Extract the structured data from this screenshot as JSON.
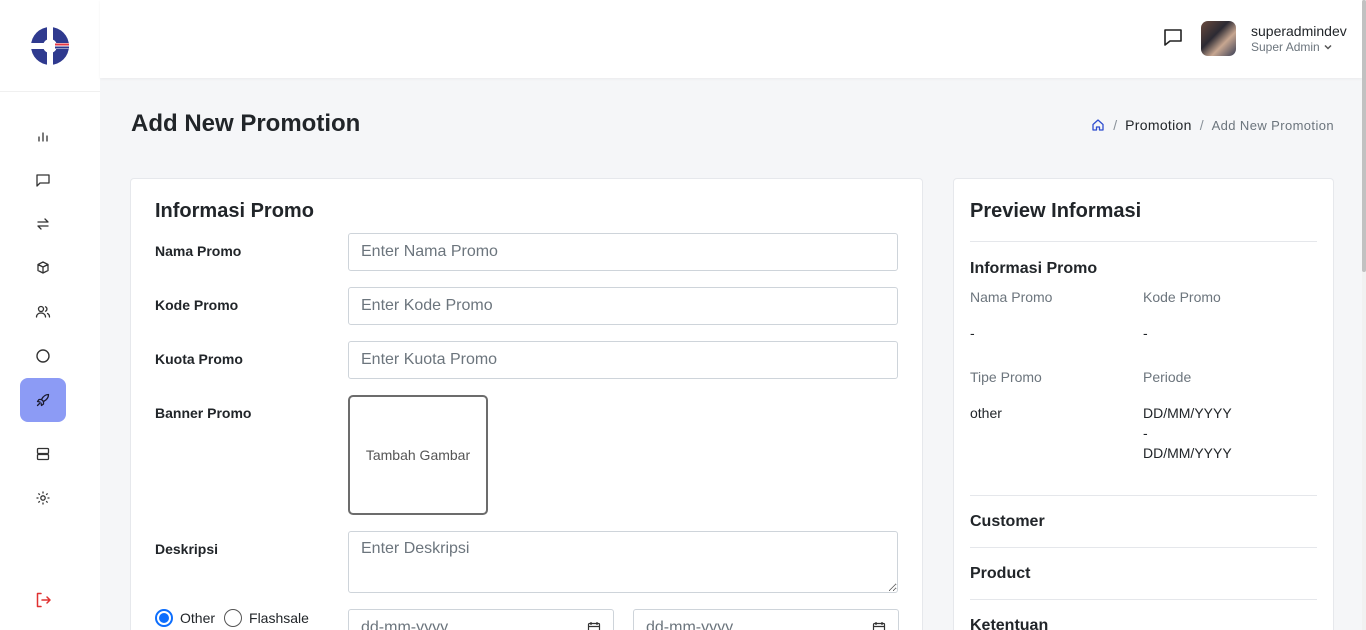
{
  "header": {
    "user_name": "superadmindev",
    "user_role": "Super Admin"
  },
  "sidebar": {
    "items": [
      {
        "icon": "bar-chart-icon"
      },
      {
        "icon": "message-icon"
      },
      {
        "icon": "transfer-icon"
      },
      {
        "icon": "box-icon"
      },
      {
        "icon": "users-icon"
      },
      {
        "icon": "circle-icon"
      },
      {
        "icon": "rocket-icon",
        "active": true
      },
      {
        "icon": "server-icon"
      },
      {
        "icon": "gear-icon"
      }
    ],
    "logout_icon": "logout-icon",
    "active_color": "#8c9bf5"
  },
  "page": {
    "title": "Add New Promotion",
    "breadcrumb": {
      "home_icon": "home-icon",
      "separator": "/",
      "link": "Promotion",
      "current": "Add New Promotion"
    }
  },
  "form": {
    "title": "Informasi Promo",
    "nama": {
      "label": "Nama Promo",
      "placeholder": "Enter Nama Promo",
      "value": ""
    },
    "kode": {
      "label": "Kode Promo",
      "placeholder": "Enter Kode Promo",
      "value": ""
    },
    "kuota": {
      "label": "Kuota Promo",
      "placeholder": "Enter Kuota Promo",
      "value": ""
    },
    "banner": {
      "label": "Banner Promo",
      "button": "Tambah Gambar"
    },
    "deskripsi": {
      "label": "Deskripsi",
      "placeholder": "Enter Deskripsi"
    },
    "tipe": {
      "options": [
        "Other",
        "Flashsale"
      ],
      "selected": "Other"
    },
    "date_start": {
      "placeholder": "dd-mm-yyyy"
    },
    "date_end": {
      "placeholder": "dd-mm-yyyy"
    },
    "date_separator": "-"
  },
  "preview": {
    "title": "Preview Informasi",
    "section_title": "Informasi Promo",
    "nama_label": "Nama Promo",
    "nama_value": "-",
    "kode_label": "Kode Promo",
    "kode_value": "-",
    "tipe_label": "Tipe Promo",
    "tipe_value": "other",
    "periode_label": "Periode",
    "periode_start": "DD/MM/YYYY",
    "periode_sep": "-",
    "periode_end": "DD/MM/YYYY",
    "customer": "Customer",
    "product": "Product",
    "ketentuan": "Ketentuan"
  }
}
